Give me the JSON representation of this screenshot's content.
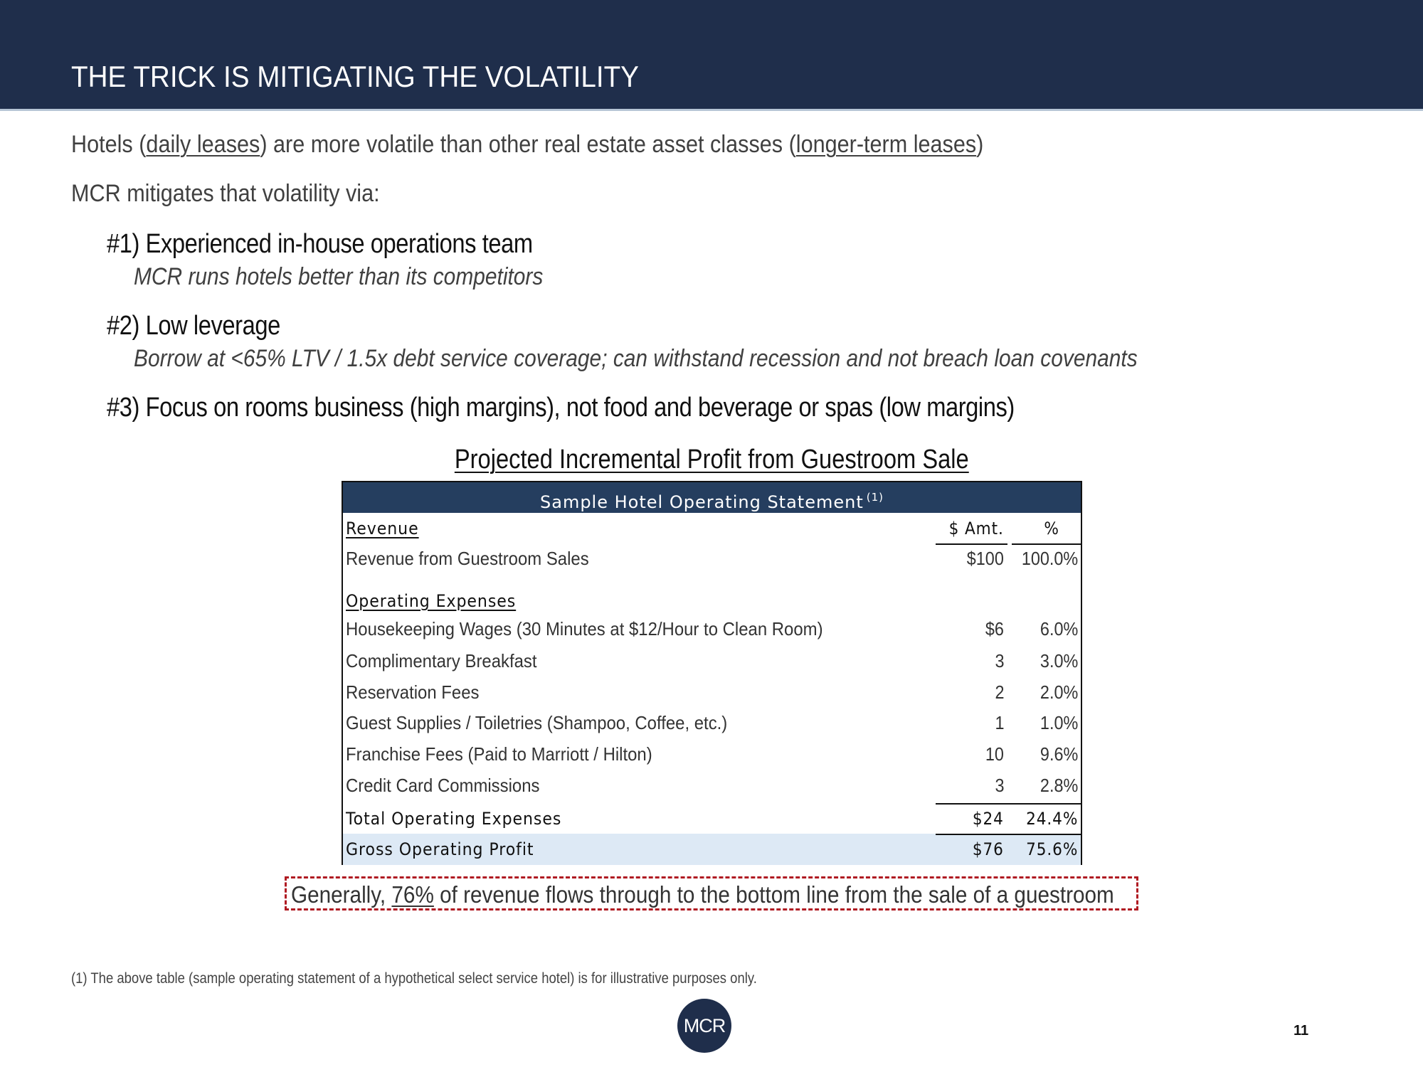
{
  "header": {
    "title": "THE TRICK IS MITIGATING THE VOLATILITY"
  },
  "intro": {
    "line1_pre": "Hotels (",
    "line1_u1": "daily leases",
    "line1_mid": ") are more volatile than other real estate asset classes (",
    "line1_u2": "longer-term leases",
    "line1_post": ")",
    "line2": "MCR mitigates that volatility via:"
  },
  "points": [
    {
      "title": "#1) Experienced in-house operations team",
      "detail": "MCR runs hotels better than its competitors"
    },
    {
      "title": "#2) Low leverage",
      "detail": "Borrow at <65% LTV / 1.5x debt service coverage; can withstand recession and not breach loan covenants"
    },
    {
      "title": "#3) Focus on rooms business (high margins), not food and beverage or spas (low margins)",
      "detail": ""
    }
  ],
  "table": {
    "title": "Projected Incremental Profit from Guestroom Sale",
    "header": "Sample Hotel Operating Statement",
    "header_note": "(1)",
    "revenue_label": "Revenue",
    "col_amt": "$ Amt.",
    "col_pct": "%",
    "revenue_rows": [
      {
        "label": "Revenue from Guestroom Sales",
        "amt": "$100",
        "pct": "100.0%"
      }
    ],
    "expenses_label": "Operating Expenses",
    "expense_rows": [
      {
        "label": "Housekeeping Wages (30 Minutes at $12/Hour to Clean Room)",
        "amt": "$6",
        "pct": "6.0%"
      },
      {
        "label": "Complimentary Breakfast",
        "amt": "3",
        "pct": "3.0%"
      },
      {
        "label": "Reservation Fees",
        "amt": "2",
        "pct": "2.0%"
      },
      {
        "label": "Guest Supplies / Toiletries (Shampoo, Coffee, etc.)",
        "amt": "1",
        "pct": "1.0%"
      },
      {
        "label": "Franchise Fees (Paid to Marriott / Hilton)",
        "amt": "10",
        "pct": "9.6%"
      },
      {
        "label": "Credit Card Commissions",
        "amt": "3",
        "pct": "2.8%"
      }
    ],
    "total": {
      "label": "Total Operating Expenses",
      "amt": "$24",
      "pct": "24.4%"
    },
    "gop": {
      "label": "Gross Operating Profit",
      "amt": "$76",
      "pct": "75.6%"
    }
  },
  "callout": {
    "pre": "Generally, ",
    "highlight": "76%",
    "post": " of revenue flows through to the bottom line from the sale of a guestroom"
  },
  "footnote": "(1) The above table (sample operating statement of a hypothetical select service hotel) is for illustrative purposes only.",
  "logo": "MCR",
  "page_number": "11",
  "colors": {
    "header_bg": "#1f2e4b",
    "table_header_bg": "#253e5f",
    "gop_bg": "#dde9f5",
    "callout_border": "#b01a22"
  }
}
